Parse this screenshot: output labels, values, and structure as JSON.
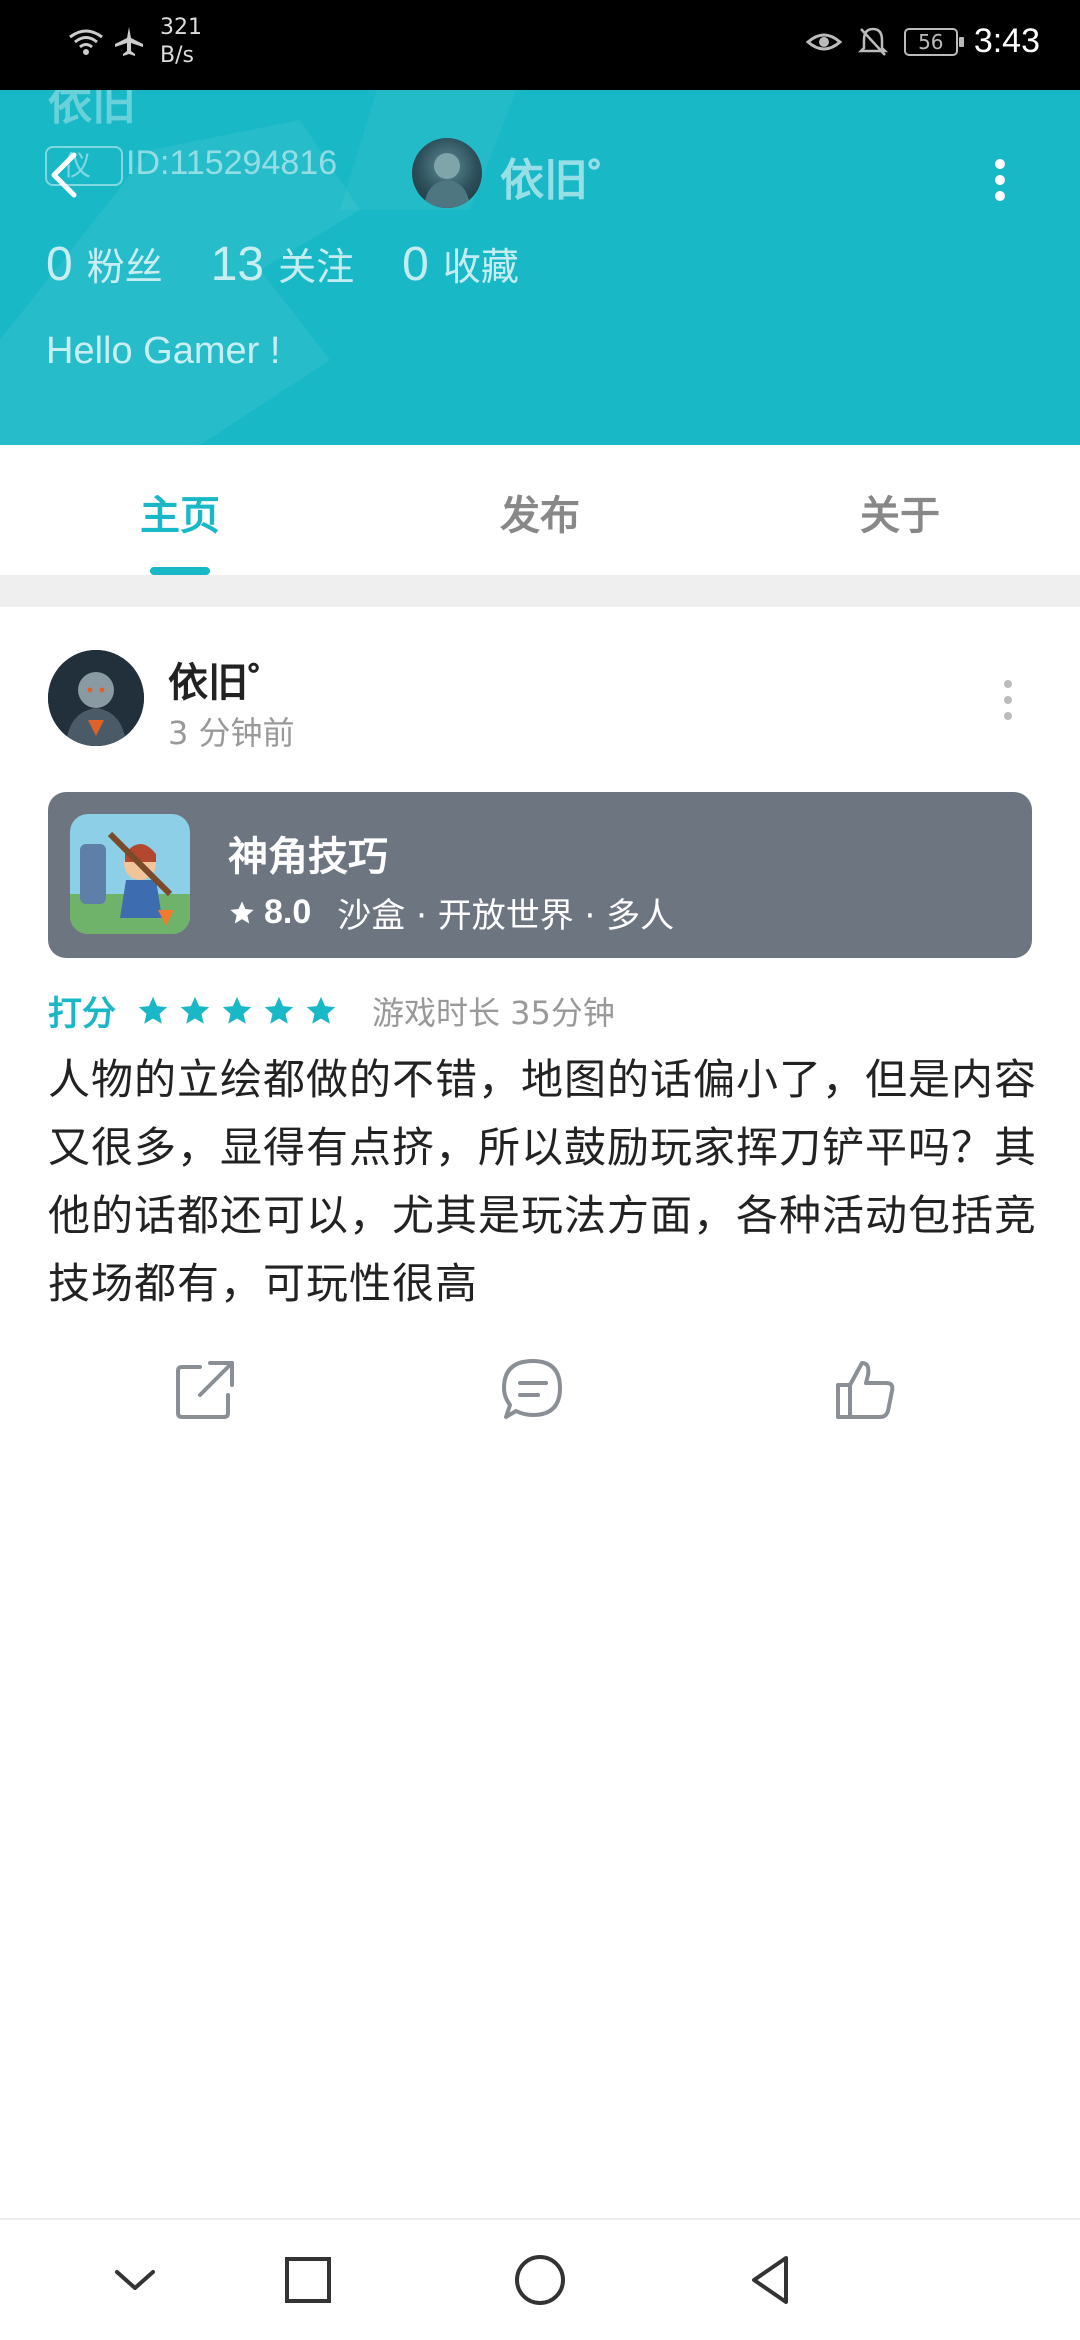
{
  "status_bar": {
    "speed_value": "321",
    "speed_unit": "B/s",
    "battery": "56",
    "time": "3:43"
  },
  "profile": {
    "ghost_name": "依旧",
    "id_badge": "仪",
    "user_id": "ID:115294816",
    "name": "依旧゜",
    "stats": [
      {
        "num": "0",
        "label": "粉丝"
      },
      {
        "num": "13",
        "label": "关注"
      },
      {
        "num": "0",
        "label": "收藏"
      }
    ],
    "bio": "Hello Gamer !"
  },
  "tabs": [
    {
      "label": "主页",
      "active": true
    },
    {
      "label": "发布",
      "active": false
    },
    {
      "label": "关于",
      "active": false
    }
  ],
  "post": {
    "author": "依旧゜",
    "time": "3 分钟前",
    "game": {
      "title": "神角技巧",
      "score": "8.0",
      "tags": "沙盒 · 开放世界 · 多人"
    },
    "rating_label": "打分",
    "stars": 5,
    "playtime": "游戏时长 35分钟",
    "body": "人物的立绘都做的不错，地图的话偏小了，但是内容又很多，显得有点挤，所以鼓励玩家挥刀铲平吗？其他的话都还可以，尤其是玩法方面，各种活动包括竞技场都有，可玩性很高"
  },
  "colors": {
    "accent": "#19b8c7",
    "card": "#6d7580"
  },
  "icons": [
    "wifi-icon",
    "airplane-icon",
    "eye-icon",
    "bell-off-icon",
    "back-icon",
    "more-icon",
    "star-icon",
    "share-icon",
    "comment-icon",
    "like-icon",
    "nav-down-icon",
    "nav-square-icon",
    "nav-circle-icon",
    "nav-back-icon"
  ]
}
